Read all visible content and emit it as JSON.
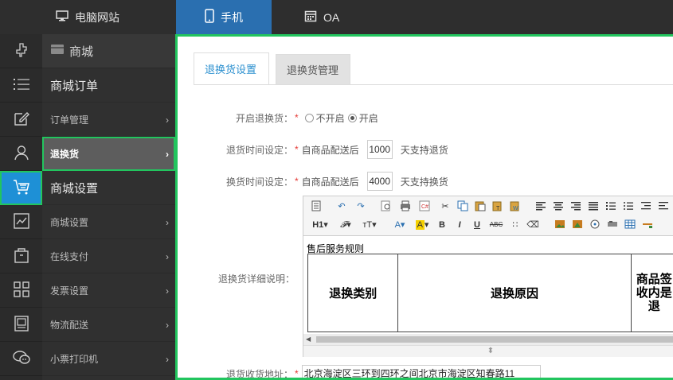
{
  "topbar": {
    "tabs": [
      {
        "label": "电脑网站",
        "icon": "monitor-icon"
      },
      {
        "label": "手机",
        "icon": "phone-icon",
        "active": true
      },
      {
        "label": "OA",
        "icon": "calendar-icon"
      }
    ]
  },
  "rail": {
    "icons": [
      "plugin-icon",
      "list-icon",
      "edit-icon",
      "user-icon",
      "cart-icon",
      "chart-icon",
      "bag-icon",
      "grid-icon",
      "image-icon",
      "chat-icon"
    ],
    "active_index": 4
  },
  "submenu": {
    "header": "商城",
    "orders_section": "商城订单",
    "order_manage": "订单管理",
    "returns": "退换货",
    "settings_section": "商城设置",
    "items": [
      "商城设置",
      "在线支付",
      "发票设置",
      "物流配送",
      "小票打印机"
    ]
  },
  "tabs": {
    "active": "退换货设置",
    "inactive": "退换货管理"
  },
  "form": {
    "enable": {
      "label": "开启退换货：",
      "options": [
        "不开启",
        "开启"
      ],
      "selected": "开启"
    },
    "return_time": {
      "label": "退货时间设定：",
      "prefix": "自商品配送后",
      "value": "1000",
      "suffix": "天支持退货"
    },
    "exchange_time": {
      "label": "换货时间设定：",
      "prefix": "自商品配送后",
      "value": "4000",
      "suffix": "天支持换货"
    },
    "detail_label": "退换货详细说明：",
    "address_label": "退货收货地址：",
    "address_value": "北京海淀区三环到四环之间北京市海淀区知春路11"
  },
  "editor": {
    "content_title": "售后服务规则",
    "table_headers": [
      "退换类别",
      "退换原因",
      "商品签收内是退"
    ]
  },
  "colors": {
    "accent_blue": "#2a6fb0",
    "highlight_green": "#22c55e",
    "tab_active_text": "#2a8fcf",
    "required": "#e53935"
  }
}
